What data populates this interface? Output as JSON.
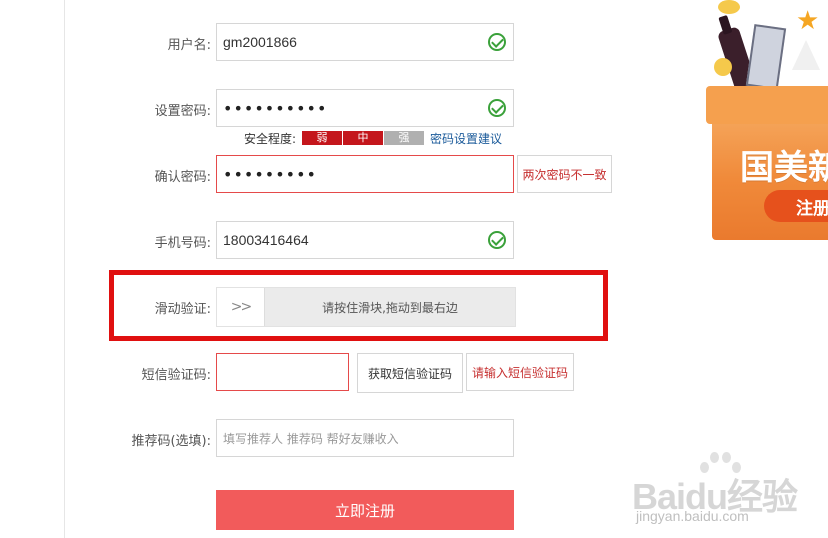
{
  "form": {
    "username": {
      "label": "用户名:",
      "value": "gm2001866"
    },
    "password": {
      "label": "设置密码:",
      "value": "••••••••••"
    },
    "strength": {
      "label": "安全程度:",
      "weak": "弱",
      "medium": "中",
      "strong": "强",
      "advice": "密码设置建议"
    },
    "confirm": {
      "label": "确认密码:",
      "value": "•••••••••",
      "error": "两次密码不一致"
    },
    "phone": {
      "label": "手机号码:",
      "value": "18003416464"
    },
    "slider": {
      "label": "滑动验证:",
      "handle": ">>",
      "text": "请按住滑块,拖动到最右边"
    },
    "sms": {
      "label": "短信验证码:",
      "value": "",
      "button": "获取短信验证码",
      "error": "请输入短信验证码"
    },
    "referral": {
      "label": "推荐码(选填):",
      "placeholder": "填写推荐人 推荐码 帮好友赚收入"
    },
    "submit": "立即注册"
  },
  "promo": {
    "title": "国美新",
    "button": "注册"
  },
  "watermark": {
    "brand": "Baidu经验",
    "url": "jingyan.baidu.com"
  },
  "colors": {
    "error": "#e54a4a",
    "success": "#3aa13a",
    "submit": "#f25b5b",
    "highlight": "#e01010",
    "strength_red": "#c4161c"
  }
}
